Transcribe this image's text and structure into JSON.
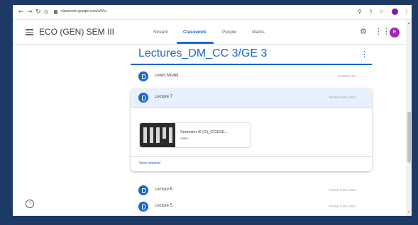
{
  "browser": {
    "url": "classroom.google.com/u/0/c/...",
    "profile_color": "#7b1fa2"
  },
  "header": {
    "menu_icon": "hamburger-icon",
    "class_title": "ECO (GEN) SEM III",
    "tabs": [
      {
        "label": "Stream",
        "active": false
      },
      {
        "label": "Classwork",
        "active": true
      },
      {
        "label": "People",
        "active": false
      },
      {
        "label": "Marks",
        "active": false
      }
    ],
    "avatar_letter": "E",
    "accent_color": "#1967d2"
  },
  "topic": {
    "title": "Lectures_DM_CC 3/GE 3"
  },
  "items": [
    {
      "title": "Lewis Model",
      "date": "Posted 5 Jan"
    },
    {
      "title": "Lecture 7",
      "date": "Posted 9 Dec 2021",
      "expanded": true,
      "attachment": {
        "title": "Semester III (G)_CC3/GE...",
        "type": "Video"
      },
      "view_label": "View material"
    },
    {
      "title": "Lecture 6",
      "date": "Posted 6 Dec 2021"
    },
    {
      "title": "Lecture 5",
      "date": "Posted 5 Dec 2021"
    }
  ]
}
